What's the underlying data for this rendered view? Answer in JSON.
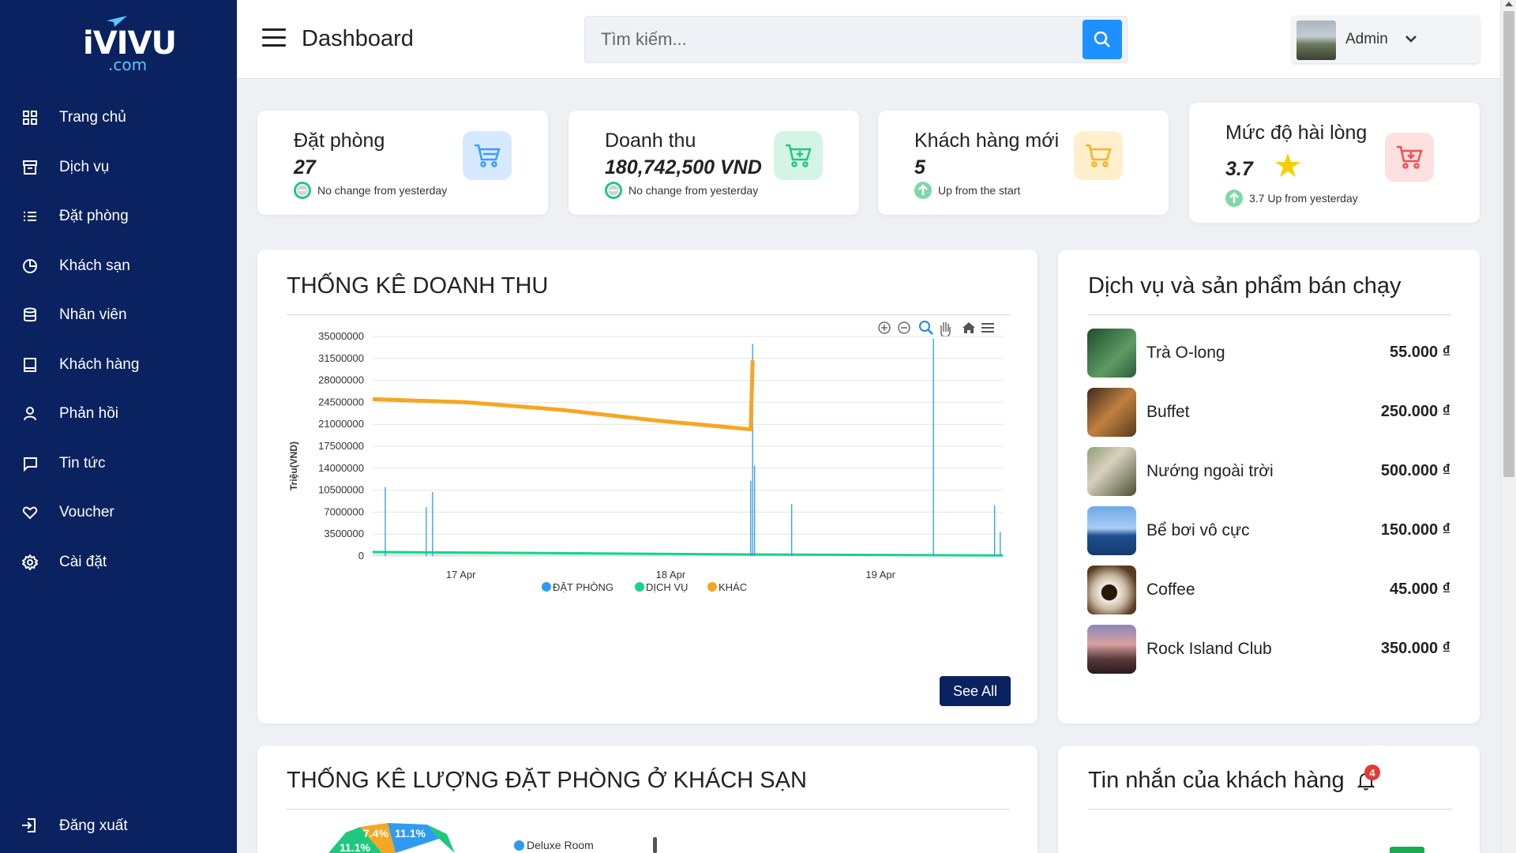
{
  "sidebar": {
    "logo_brand": "iVIVU",
    "logo_domain": ".com",
    "items": [
      {
        "label": "Trang chủ",
        "icon": "grid-icon"
      },
      {
        "label": "Dịch vụ",
        "icon": "archive-icon"
      },
      {
        "label": "Đặt phòng",
        "icon": "list-icon"
      },
      {
        "label": "Khách sạn",
        "icon": "pie-chart-icon"
      },
      {
        "label": "Nhân viên",
        "icon": "database-icon"
      },
      {
        "label": "Khách hàng",
        "icon": "book-icon"
      },
      {
        "label": "Phản hồi",
        "icon": "user-icon"
      },
      {
        "label": "Tin tức",
        "icon": "message-icon"
      },
      {
        "label": "Voucher",
        "icon": "heart-icon"
      },
      {
        "label": "Cài đặt",
        "icon": "gear-icon"
      }
    ],
    "logout_label": "Đăng xuất"
  },
  "header": {
    "title": "Dashboard",
    "search_placeholder": "Tìm kiếm...",
    "user_name": "Admin"
  },
  "stats": [
    {
      "title": "Đặt phòng",
      "value": "27",
      "note": "No change from yesterday",
      "icon_color": "#d7e9ff",
      "cart_color": "#3b9cff",
      "note_icon": "minus"
    },
    {
      "title": "Doanh thu",
      "value": "180,742,500 VND",
      "note": "No change from yesterday",
      "icon_color": "#d4f5e6",
      "cart_color": "#1ec97f",
      "note_icon": "minus"
    },
    {
      "title": "Khách hàng mới",
      "value": "5",
      "note": "Up from the start",
      "icon_color": "#ffefcc",
      "cart_color": "#ffb020",
      "note_icon": "up"
    },
    {
      "title": "Mức độ hài lòng",
      "value": "3.7",
      "note": "3.7 Up from yesterday",
      "icon_color": "#fde0e0",
      "cart_color": "#f05050",
      "note_icon": "up"
    }
  ],
  "revenue": {
    "title": "THỐNG KÊ DOANH THU",
    "see_all": "See All"
  },
  "chart_data": {
    "type": "line",
    "ylabel": "Triệu(VND)",
    "ylim": [
      0,
      35000000
    ],
    "yticks": [
      "35000000",
      "31500000",
      "28000000",
      "24500000",
      "21000000",
      "17500000",
      "14000000",
      "10500000",
      "7000000",
      "3500000",
      "0"
    ],
    "xticks": [
      "17 Apr",
      "18 Apr",
      "19 Apr"
    ],
    "legend": [
      "ĐẶT PHÒNG",
      "DỊCH VỤ",
      "KHÁC"
    ],
    "series": [
      {
        "name": "ĐẶT PHÒNG",
        "color": "#2f9bf0",
        "spikes": [
          {
            "x": 0.02,
            "y": 11000000
          },
          {
            "x": 0.085,
            "y": 7800000
          },
          {
            "x": 0.095,
            "y": 10200000
          },
          {
            "x": 0.6,
            "y": 12000000
          },
          {
            "x": 0.603,
            "y": 33800000
          },
          {
            "x": 0.606,
            "y": 14400000
          },
          {
            "x": 0.665,
            "y": 8300000
          },
          {
            "x": 0.89,
            "y": 34700000
          },
          {
            "x": 0.987,
            "y": 8100000
          },
          {
            "x": 0.996,
            "y": 3800000
          }
        ]
      },
      {
        "name": "DỊCH VỤ",
        "color": "#17d38c",
        "points": [
          {
            "x": 0.0,
            "y": 650000
          },
          {
            "x": 0.3,
            "y": 450000
          },
          {
            "x": 0.6,
            "y": 250000
          },
          {
            "x": 1.0,
            "y": 100000
          }
        ]
      },
      {
        "name": "KHÁC",
        "color": "#f5a623",
        "points": [
          {
            "x": 0.0,
            "y": 25000000
          },
          {
            "x": 0.15,
            "y": 24500000
          },
          {
            "x": 0.3,
            "y": 23300000
          },
          {
            "x": 0.45,
            "y": 21600000
          },
          {
            "x": 0.6,
            "y": 20200000
          },
          {
            "x": 0.603,
            "y": 31200000
          }
        ]
      }
    ]
  },
  "products": {
    "title": "Dịch vụ và sản phẩm bán chạy",
    "items": [
      {
        "name": "Trà O-long",
        "price": "55.000 ₫",
        "color": "#2c5b3a"
      },
      {
        "name": "Buffet",
        "price": "250.000 ₫",
        "color": "#8a5a2b"
      },
      {
        "name": "Nướng ngoài trời",
        "price": "500.000 ₫",
        "color": "#6b6f4a"
      },
      {
        "name": "Bể bơi vô cực",
        "price": "150.000 ₫",
        "color": "#3b7bc8"
      },
      {
        "name": "Coffee",
        "price": "45.000 ₫",
        "color": "#5a3a24"
      },
      {
        "name": "Rock Island Club",
        "price": "350.000 ₫",
        "color": "#7d5a6b"
      }
    ]
  },
  "bookings": {
    "title": "THỐNG KÊ LƯỢNG ĐẶT PHÒNG Ở KHÁCH SẠN",
    "legend_first": "Deluxe Room",
    "pie_labels": [
      "7.4%",
      "11.1%",
      "11.1%"
    ]
  },
  "messages": {
    "title": "Tin nhắn của khách hàng",
    "badge": "4"
  }
}
